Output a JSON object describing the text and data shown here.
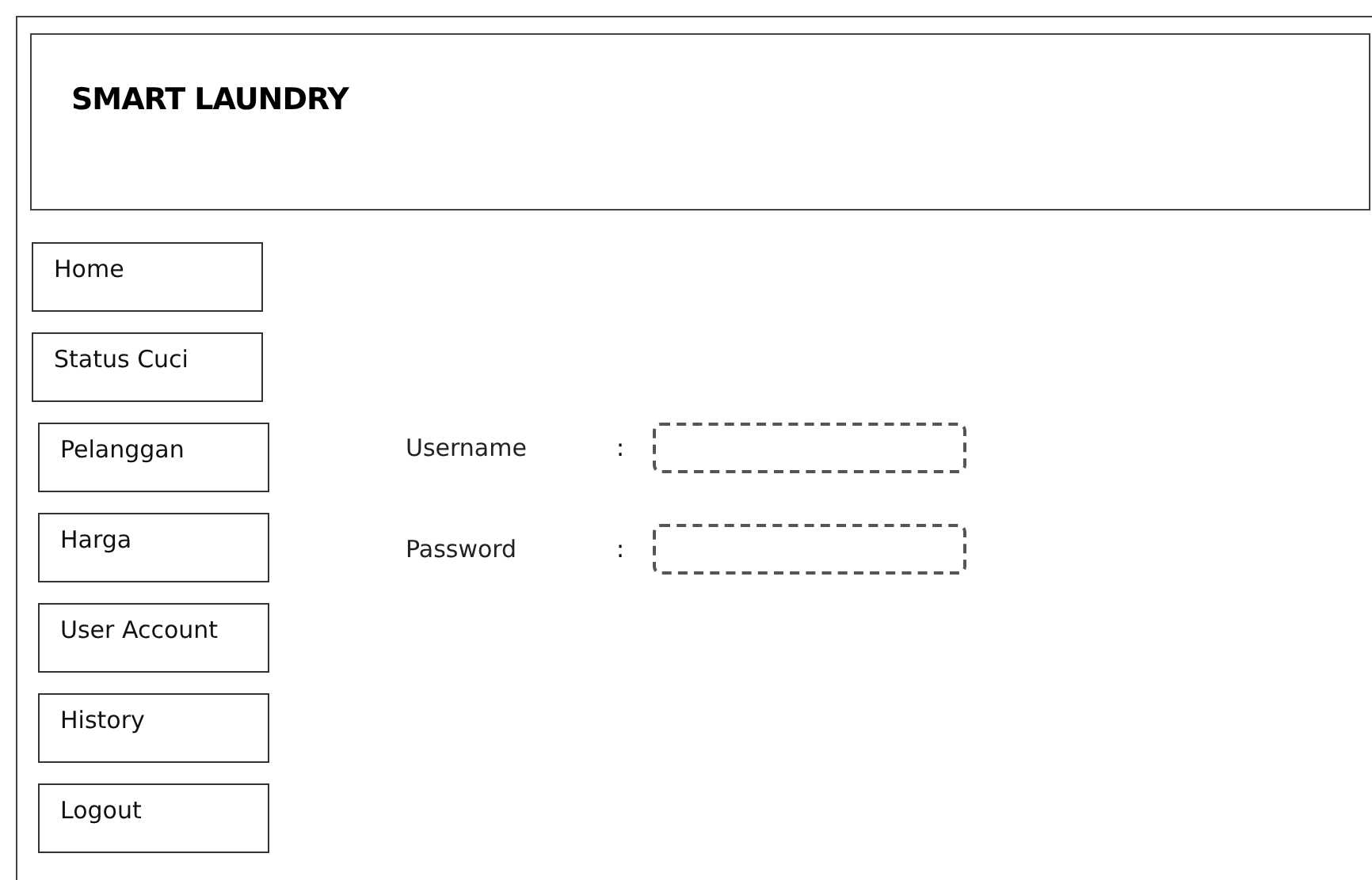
{
  "header": {
    "title": "SMART LAUNDRY"
  },
  "nav": [
    {
      "label": "Home"
    },
    {
      "label": "Status Cuci"
    },
    {
      "label": "Pelanggan"
    },
    {
      "label": "Harga"
    },
    {
      "label": "User Account"
    },
    {
      "label": "History"
    },
    {
      "label": "Logout"
    }
  ],
  "form": {
    "fields": [
      {
        "label": "Username",
        "separator": ":"
      },
      {
        "label": "Password",
        "separator": ":"
      }
    ]
  }
}
